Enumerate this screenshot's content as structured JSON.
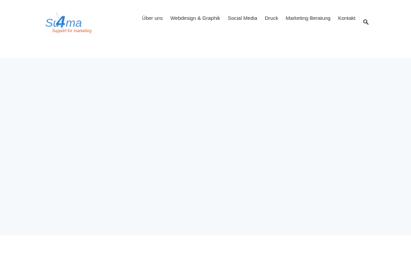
{
  "logo": {
    "name_part1": "Su",
    "name_digit": "4",
    "name_part2": "ma",
    "tagline": "Support for marketing",
    "colors": {
      "blue": "#3d8fd6",
      "accent": "#4aa3e0",
      "tagline": "#e05a2a"
    }
  },
  "nav": {
    "items": [
      {
        "label": "Über uns"
      },
      {
        "label": "Webdesign & Graphik"
      },
      {
        "label": "Social Media"
      },
      {
        "label": "Druck"
      },
      {
        "label": "Marketing Beratung"
      },
      {
        "label": "Kontakt"
      }
    ],
    "search_icon": "search-icon"
  },
  "colors": {
    "hero_background": "#f6f9fc",
    "nav_text": "#333333"
  }
}
